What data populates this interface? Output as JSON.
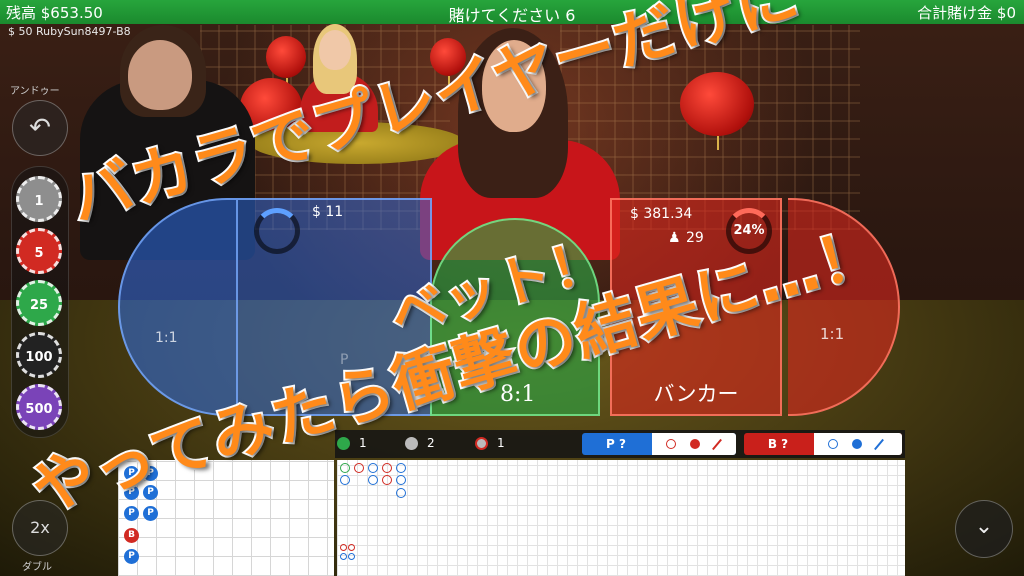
{
  "topbar": {
    "balance": "残高 $653.50",
    "status": "賭けてください 6",
    "total_bet": "合計賭け金 $0"
  },
  "user": {
    "label": "$ 50 RubySun8497-B8"
  },
  "controls": {
    "undo_label": "アンドゥー",
    "undo_icon": "↶",
    "double_label": "ダブル",
    "double_text": "2x",
    "down_icon": "⌄"
  },
  "chips": [
    {
      "value": "1",
      "color": "#8e8e8e"
    },
    {
      "value": "5",
      "color": "#d12a22"
    },
    {
      "value": "25",
      "color": "#2ea84a"
    },
    {
      "value": "100",
      "color": "#222222"
    },
    {
      "value": "500",
      "color": "#7a43b8"
    }
  ],
  "bets": {
    "player_amount": "$ 11",
    "player_ratio": "1:1",
    "tie_ratio": "8:1",
    "banker_amount": "$ 381.34",
    "banker_players": "29",
    "banker_pct": "24%",
    "banker_label": "バンカー",
    "banker_ratio": "1:1",
    "player_faint": "P"
  },
  "stats": {
    "tie_count": "1",
    "player_count": "2",
    "banker_count": "1",
    "player_predict": "P ?",
    "banker_predict": "B ?"
  },
  "bead_road": [
    "P",
    "P",
    "P",
    "P",
    "P",
    "P",
    "B",
    "P"
  ],
  "colors": {
    "accent_green": "#27a53c",
    "player_blue": "#1f6fd6",
    "banker_red": "#d12a22",
    "caption_orange": "#ff8a1a"
  },
  "caption": {
    "line1": "バカラでプレイヤーだけに",
    "line2": "ベット！",
    "line3": "やってみたら衝撃の結果に…！"
  }
}
